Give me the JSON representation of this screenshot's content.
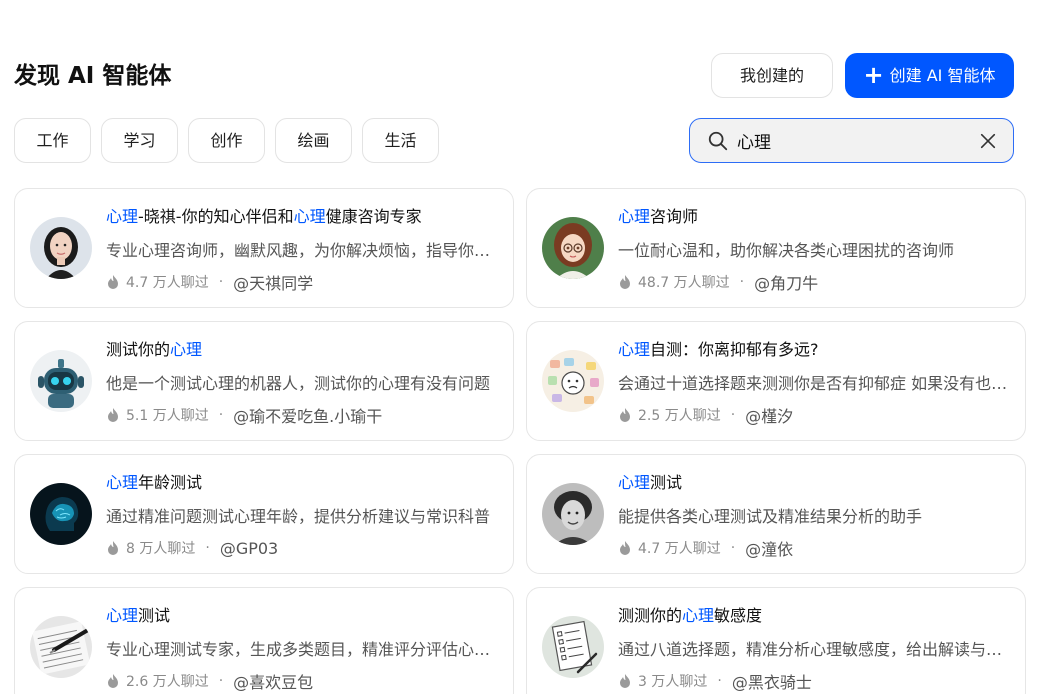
{
  "header": {
    "title": "发现 AI 智能体",
    "my_created_label": "我创建的",
    "create_label": "创建 AI 智能体"
  },
  "categories": [
    "工作",
    "学习",
    "创作",
    "绘画",
    "生活"
  ],
  "search": {
    "value": "心理",
    "placeholder": ""
  },
  "cards": [
    {
      "name_parts": [
        "心理",
        "-晓祺-你的知心伴侣和",
        "心理",
        "健康咨询专家"
      ],
      "description": "专业心理咨询师，幽默风趣，为你解决烦恼，指导你心理健康成长",
      "count": "4.7 万人聊过",
      "author": "@天祺同学",
      "avatar_icon": "woman-portrait-icon"
    },
    {
      "name_parts": [
        "心理",
        "咨询师"
      ],
      "description": "一位耐心温和，助你解决各类心理困扰的咨询师",
      "count": "48.7 万人聊过",
      "author": "@角刀牛",
      "avatar_icon": "anime-girl-glasses-icon"
    },
    {
      "name_parts": [
        "测试你的",
        "心理"
      ],
      "description": "他是一个测试心理的机器人，测试你的心理有没有问题",
      "count": "5.1 万人聊过",
      "author": "@瑜不爱吃鱼.小瑜干",
      "avatar_icon": "robot-icon"
    },
    {
      "name_parts": [
        "心理",
        "自测：你离抑郁有多远?"
      ],
      "description": "会通过十道选择题来测测你是否有抑郁症 如果没有也会给出建议",
      "count": "2.5 万人聊过",
      "author": "@槿汐",
      "avatar_icon": "emotion-chart-icon"
    },
    {
      "name_parts": [
        "心理",
        "年龄测试"
      ],
      "description": "通过精准问题测试心理年龄，提供分析建议与常识科普",
      "count": "8 万人聊过",
      "author": "@GP03",
      "avatar_icon": "brain-head-icon"
    },
    {
      "name_parts": [
        "心理",
        "测试"
      ],
      "description": "能提供各类心理测试及精准结果分析的助手",
      "count": "4.7 万人聊过",
      "author": "@潼依",
      "avatar_icon": "old-man-portrait-icon"
    },
    {
      "name_parts": [
        "心理",
        "测试"
      ],
      "description": "专业心理测试专家，生成多类题目，精准评分评估心理状态",
      "count": "2.6 万人聊过",
      "author": "@喜欢豆包",
      "avatar_icon": "pen-paper-icon"
    },
    {
      "name_parts": [
        "测测你的",
        "心理",
        "敏感度"
      ],
      "description": "通过八道选择题，精准分析心理敏感度，给出解读与建议",
      "count": "3 万人聊过",
      "author": "@黑衣骑士",
      "avatar_icon": "checklist-icon"
    }
  ],
  "colors": {
    "accent": "#0057ff",
    "highlight": "#0057ff",
    "border": "#e6e6e6"
  }
}
